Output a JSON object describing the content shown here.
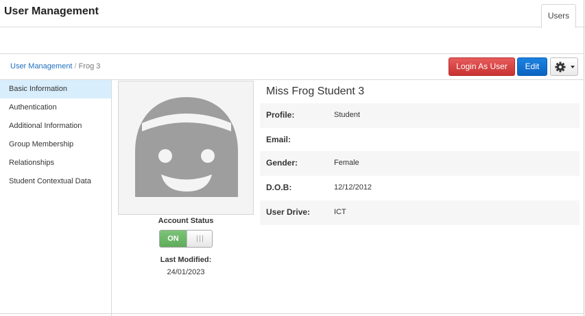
{
  "app": {
    "title": "User Management"
  },
  "tabs": [
    {
      "label": "Users"
    }
  ],
  "breadcrumb": {
    "root": "User Management",
    "separator": "/",
    "current": "Frog 3"
  },
  "actions": {
    "login_as_user": "Login As User",
    "edit": "Edit",
    "settings_icon": "gear-icon"
  },
  "sidebar": {
    "items": [
      {
        "label": "Basic Information",
        "active": true
      },
      {
        "label": "Authentication",
        "active": false
      },
      {
        "label": "Additional Information",
        "active": false
      },
      {
        "label": "Group Membership",
        "active": false
      },
      {
        "label": "Relationships",
        "active": false
      },
      {
        "label": "Student Contextual Data",
        "active": false
      }
    ]
  },
  "profile": {
    "name": "Miss Frog Student 3",
    "avatar_icon": "female-student-avatar-icon",
    "account_status_label": "Account Status",
    "account_status_value": "ON",
    "last_modified_label": "Last Modified:",
    "last_modified_value": "24/01/2023",
    "fields": [
      {
        "label": "Profile:",
        "value": "Student"
      },
      {
        "label": "Email:",
        "value": ""
      },
      {
        "label": "Gender:",
        "value": "Female"
      },
      {
        "label": "D.O.B:",
        "value": "12/12/2012"
      },
      {
        "label": "User Drive:",
        "value": "ICT"
      }
    ]
  },
  "colors": {
    "accent_blue": "#0b63c1",
    "danger_red": "#d63b3b",
    "toggle_green": "#6bb867",
    "active_nav_bg": "#d9eefc",
    "link": "#1f6fbf"
  }
}
